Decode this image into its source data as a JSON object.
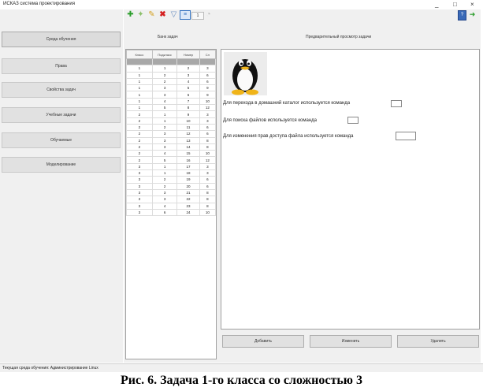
{
  "window": {
    "title": "ИСКАЗ система проектирования",
    "minimize_glyph": "_",
    "maximize_glyph": "□",
    "close_glyph": "×"
  },
  "sidebar": {
    "items": [
      {
        "label": "Среда обучения",
        "active": true
      },
      {
        "label": "Права"
      },
      {
        "label": "Свойства задач"
      },
      {
        "label": "Учебные задачи"
      },
      {
        "label": "Обучаемые"
      },
      {
        "label": "Моделирование"
      }
    ]
  },
  "toolbar": {
    "icons": [
      "add-green-icon",
      "add-key-icon",
      "edit-pencil-icon",
      "delete-x-icon",
      "filter-icon",
      "list-dropdown-icon",
      "refresh-icon"
    ],
    "level_value": "1",
    "right_icons": [
      "book-icon",
      "exit-icon"
    ]
  },
  "bank": {
    "title": "Банк задач",
    "columns": [
      "Класс",
      "Подкласс",
      "Номер",
      "Сл"
    ],
    "rows": [
      [
        "1",
        "1",
        "1",
        "3"
      ],
      [
        "1",
        "1",
        "2",
        "3"
      ],
      [
        "1",
        "2",
        "3",
        "6"
      ],
      [
        "1",
        "2",
        "4",
        "6"
      ],
      [
        "1",
        "3",
        "5",
        "9"
      ],
      [
        "1",
        "3",
        "6",
        "9"
      ],
      [
        "1",
        "4",
        "7",
        "10"
      ],
      [
        "1",
        "5",
        "8",
        "12"
      ],
      [
        "2",
        "1",
        "9",
        "3"
      ],
      [
        "2",
        "1",
        "10",
        "3"
      ],
      [
        "2",
        "2",
        "11",
        "6"
      ],
      [
        "2",
        "3",
        "12",
        "6"
      ],
      [
        "2",
        "3",
        "13",
        "8"
      ],
      [
        "2",
        "3",
        "14",
        "8"
      ],
      [
        "2",
        "4",
        "15",
        "10"
      ],
      [
        "2",
        "5",
        "16",
        "12"
      ],
      [
        "3",
        "1",
        "17",
        "3"
      ],
      [
        "3",
        "1",
        "18",
        "3"
      ],
      [
        "3",
        "2",
        "19",
        "6"
      ],
      [
        "3",
        "2",
        "20",
        "6"
      ],
      [
        "3",
        "3",
        "21",
        "8"
      ],
      [
        "3",
        "3",
        "22",
        "8"
      ],
      [
        "3",
        "4",
        "23",
        "8"
      ],
      [
        "3",
        "6",
        "24",
        "10"
      ]
    ],
    "selected_row": 0
  },
  "preview": {
    "title": "Предварительный просмотр задачи",
    "image_icon": "tux-penguin-icon",
    "questions": [
      "Для перехода в домашний каталог используется команда",
      "Для поиска файлов используется команда",
      "Для изменения прав доступа файла используется команда"
    ]
  },
  "actions": {
    "add": "Добавить",
    "edit": "Изменить",
    "delete": "Удалить"
  },
  "status": {
    "text": "Текущая среда обучения: Администрирование Linux"
  },
  "caption": {
    "text": "Рис. 6. Задача 1-го класса со сложностью 3"
  }
}
